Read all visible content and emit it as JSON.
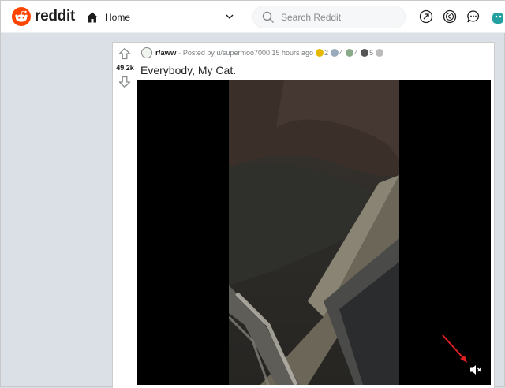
{
  "header": {
    "brand": "reddit",
    "feed": "Home",
    "search_placeholder": "Search Reddit",
    "icons": [
      "popular-icon",
      "coins-icon",
      "chat-icon",
      "snoo-avatar-icon"
    ]
  },
  "post": {
    "score": "49.2k",
    "subreddit": "r/aww",
    "posted_by": "· Posted by u/supermoo7000 15 hours ago",
    "awards": [
      {
        "icon": "gold-award-icon",
        "count": "2",
        "color": "#e6b800"
      },
      {
        "icon": "award-icon",
        "count": "4",
        "color": "#9ab"
      },
      {
        "icon": "award-icon-2",
        "count": "4",
        "color": "#8a8"
      },
      {
        "icon": "award-icon-3",
        "count": "5",
        "color": "#555"
      }
    ],
    "title": "Everybody, My Cat."
  },
  "video": {
    "muted": true
  },
  "colors": {
    "brand": "#ff4500",
    "annotation_arrow": "#e02020"
  }
}
